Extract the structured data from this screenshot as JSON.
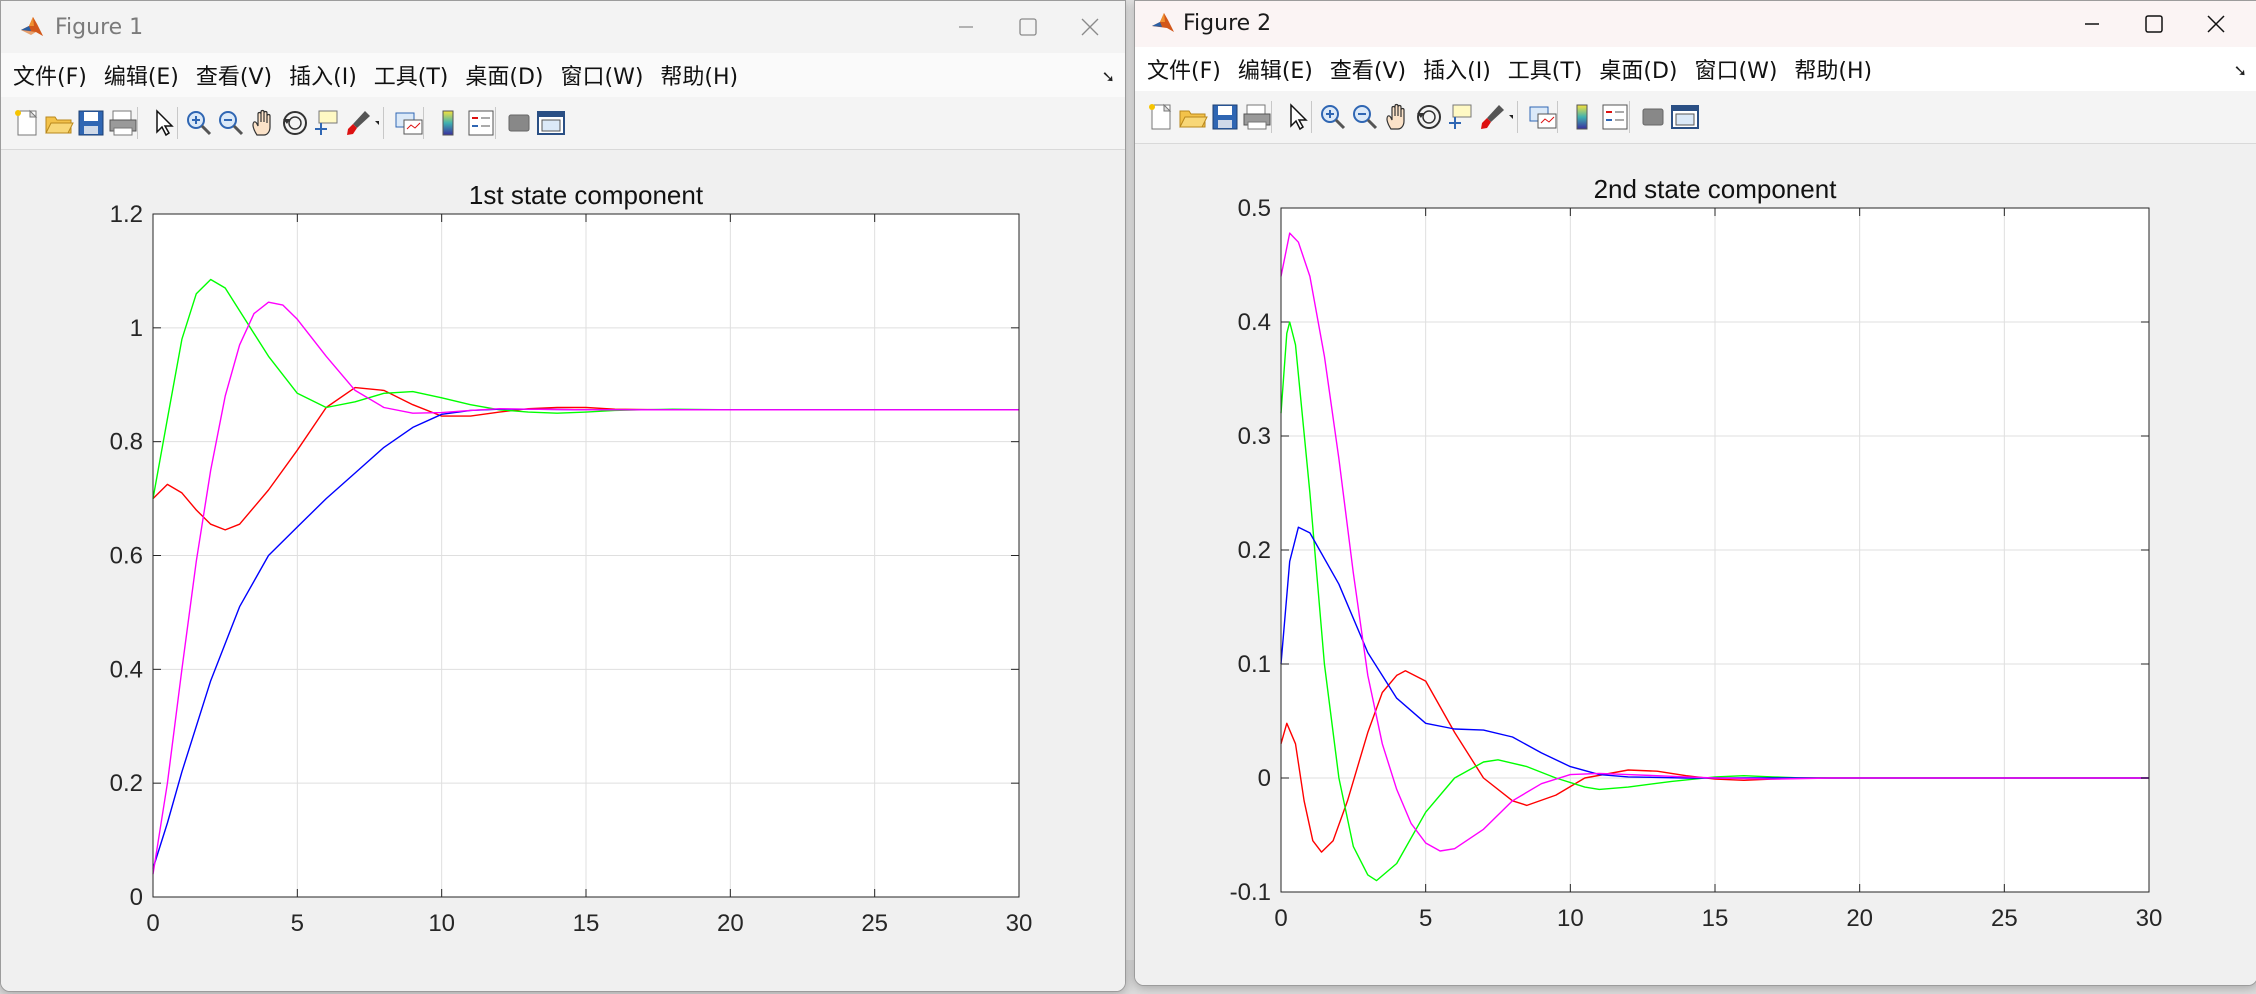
{
  "menu": [
    "文件(F)",
    "编辑(E)",
    "查看(V)",
    "插入(I)",
    "工具(T)",
    "桌面(D)",
    "窗口(W)",
    "帮助(H)"
  ],
  "figures": [
    {
      "title": "Figure 1",
      "active": false
    },
    {
      "title": "Figure 2",
      "active": true
    }
  ],
  "colors": {
    "red": "#ff0000",
    "green": "#00ff00",
    "blue": "#0000ff",
    "magenta": "#ff00ff"
  },
  "toolbar_icons": [
    "new-figure-icon",
    "open-file-icon",
    "save-icon",
    "print-icon",
    "pointer-icon",
    "zoom-in-icon",
    "zoom-out-icon",
    "pan-hand-icon",
    "rotate-3d-icon",
    "data-cursor-icon",
    "brush-icon",
    "brush-dropdown-icon",
    "link-plot-icon",
    "colorbar-icon",
    "legend-icon",
    "hide-plot-tools-icon",
    "show-plot-tools-icon"
  ],
  "chart_data": [
    {
      "type": "line",
      "title": "1st state component",
      "xlabel": "",
      "ylabel": "",
      "xlim": [
        0,
        30
      ],
      "ylim": [
        0,
        1.2
      ],
      "xticks": [
        "0",
        "5",
        "10",
        "15",
        "20",
        "25",
        "30"
      ],
      "yticks": [
        "0",
        "0.2",
        "0.4",
        "0.6",
        "0.8",
        "1",
        "1.2"
      ],
      "grid": true,
      "series": [
        {
          "color": "#ff0000",
          "points": [
            [
              0,
              0.7
            ],
            [
              0.5,
              0.725
            ],
            [
              1,
              0.71
            ],
            [
              1.5,
              0.68
            ],
            [
              2,
              0.655
            ],
            [
              2.5,
              0.645
            ],
            [
              3,
              0.655
            ],
            [
              4,
              0.715
            ],
            [
              5,
              0.785
            ],
            [
              6,
              0.86
            ],
            [
              7,
              0.895
            ],
            [
              8,
              0.89
            ],
            [
              9,
              0.865
            ],
            [
              10,
              0.845
            ],
            [
              11,
              0.845
            ],
            [
              12,
              0.852
            ],
            [
              13,
              0.858
            ],
            [
              14,
              0.86
            ],
            [
              15,
              0.86
            ],
            [
              16,
              0.857
            ],
            [
              18,
              0.856
            ],
            [
              20,
              0.856
            ],
            [
              30,
              0.856
            ]
          ]
        },
        {
          "color": "#00ff00",
          "points": [
            [
              0,
              0.7
            ],
            [
              0.5,
              0.84
            ],
            [
              1,
              0.98
            ],
            [
              1.5,
              1.06
            ],
            [
              2,
              1.085
            ],
            [
              2.5,
              1.07
            ],
            [
              3,
              1.03
            ],
            [
              4,
              0.95
            ],
            [
              5,
              0.885
            ],
            [
              6,
              0.86
            ],
            [
              7,
              0.87
            ],
            [
              8,
              0.885
            ],
            [
              9,
              0.888
            ],
            [
              10,
              0.877
            ],
            [
              11,
              0.865
            ],
            [
              12,
              0.856
            ],
            [
              13,
              0.852
            ],
            [
              14,
              0.85
            ],
            [
              15,
              0.852
            ],
            [
              16,
              0.855
            ],
            [
              18,
              0.857
            ],
            [
              20,
              0.856
            ],
            [
              30,
              0.856
            ]
          ]
        },
        {
          "color": "#0000ff",
          "points": [
            [
              0,
              0.05
            ],
            [
              0.5,
              0.13
            ],
            [
              1,
              0.22
            ],
            [
              2,
              0.38
            ],
            [
              3,
              0.51
            ],
            [
              4,
              0.6
            ],
            [
              5,
              0.65
            ],
            [
              6,
              0.7
            ],
            [
              7,
              0.745
            ],
            [
              8,
              0.79
            ],
            [
              9,
              0.825
            ],
            [
              10,
              0.848
            ],
            [
              11,
              0.855
            ],
            [
              12,
              0.857
            ],
            [
              13,
              0.857
            ],
            [
              15,
              0.856
            ],
            [
              20,
              0.856
            ],
            [
              30,
              0.856
            ]
          ]
        },
        {
          "color": "#ff00ff",
          "points": [
            [
              0,
              0.04
            ],
            [
              0.5,
              0.2
            ],
            [
              1,
              0.4
            ],
            [
              1.5,
              0.59
            ],
            [
              2,
              0.75
            ],
            [
              2.5,
              0.88
            ],
            [
              3,
              0.97
            ],
            [
              3.5,
              1.025
            ],
            [
              4,
              1.045
            ],
            [
              4.5,
              1.04
            ],
            [
              5,
              1.015
            ],
            [
              6,
              0.95
            ],
            [
              7,
              0.89
            ],
            [
              8,
              0.86
            ],
            [
              9,
              0.85
            ],
            [
              10,
              0.851
            ],
            [
              11,
              0.855
            ],
            [
              12,
              0.858
            ],
            [
              13,
              0.857
            ],
            [
              15,
              0.856
            ],
            [
              20,
              0.856
            ],
            [
              30,
              0.856
            ]
          ]
        }
      ]
    },
    {
      "type": "line",
      "title": "2nd state component",
      "xlabel": "",
      "ylabel": "",
      "xlim": [
        0,
        30
      ],
      "ylim": [
        -0.1,
        0.5
      ],
      "xticks": [
        "0",
        "5",
        "10",
        "15",
        "20",
        "25",
        "30"
      ],
      "yticks": [
        "-0.1",
        "0",
        "0.1",
        "0.2",
        "0.3",
        "0.4",
        "0.5"
      ],
      "grid": true,
      "series": [
        {
          "color": "#ff0000",
          "points": [
            [
              0,
              0.03
            ],
            [
              0.2,
              0.048
            ],
            [
              0.5,
              0.03
            ],
            [
              0.8,
              -0.02
            ],
            [
              1.1,
              -0.055
            ],
            [
              1.4,
              -0.065
            ],
            [
              1.8,
              -0.055
            ],
            [
              2.3,
              -0.02
            ],
            [
              3,
              0.04
            ],
            [
              3.5,
              0.075
            ],
            [
              4,
              0.09
            ],
            [
              4.3,
              0.094
            ],
            [
              5,
              0.085
            ],
            [
              6,
              0.04
            ],
            [
              7,
              0.0
            ],
            [
              8,
              -0.02
            ],
            [
              8.5,
              -0.024
            ],
            [
              9.5,
              -0.015
            ],
            [
              10.5,
              0.0
            ],
            [
              12,
              0.007
            ],
            [
              13,
              0.006
            ],
            [
              14,
              0.002
            ],
            [
              15,
              -0.001
            ],
            [
              16,
              -0.002
            ],
            [
              17,
              -0.001
            ],
            [
              18,
              0.0
            ],
            [
              30,
              0.0
            ]
          ]
        },
        {
          "color": "#00ff00",
          "points": [
            [
              0,
              0.32
            ],
            [
              0.2,
              0.39
            ],
            [
              0.3,
              0.4
            ],
            [
              0.5,
              0.38
            ],
            [
              1,
              0.25
            ],
            [
              1.5,
              0.1
            ],
            [
              2,
              0.0
            ],
            [
              2.5,
              -0.06
            ],
            [
              3,
              -0.085
            ],
            [
              3.3,
              -0.09
            ],
            [
              4,
              -0.075
            ],
            [
              5,
              -0.03
            ],
            [
              6,
              0.0
            ],
            [
              7,
              0.014
            ],
            [
              7.5,
              0.016
            ],
            [
              8.5,
              0.01
            ],
            [
              9.5,
              0.0
            ],
            [
              10.5,
              -0.008
            ],
            [
              11,
              -0.01
            ],
            [
              12,
              -0.008
            ],
            [
              13.5,
              -0.003
            ],
            [
              15,
              0.001
            ],
            [
              16,
              0.002
            ],
            [
              17,
              0.001
            ],
            [
              18,
              0.0
            ],
            [
              30,
              0.0
            ]
          ]
        },
        {
          "color": "#0000ff",
          "points": [
            [
              0,
              0.1
            ],
            [
              0.3,
              0.19
            ],
            [
              0.6,
              0.22
            ],
            [
              1,
              0.215
            ],
            [
              2,
              0.17
            ],
            [
              3,
              0.11
            ],
            [
              4,
              0.07
            ],
            [
              5,
              0.048
            ],
            [
              6,
              0.043
            ],
            [
              7,
              0.042
            ],
            [
              8,
              0.036
            ],
            [
              9,
              0.022
            ],
            [
              10,
              0.01
            ],
            [
              11,
              0.003
            ],
            [
              12,
              0.001
            ],
            [
              14,
              0.0
            ],
            [
              30,
              0.0
            ]
          ]
        },
        {
          "color": "#ff00ff",
          "points": [
            [
              0,
              0.44
            ],
            [
              0.3,
              0.478
            ],
            [
              0.6,
              0.47
            ],
            [
              1,
              0.44
            ],
            [
              1.5,
              0.37
            ],
            [
              2,
              0.28
            ],
            [
              2.5,
              0.18
            ],
            [
              3,
              0.09
            ],
            [
              3.5,
              0.03
            ],
            [
              4,
              -0.01
            ],
            [
              4.5,
              -0.04
            ],
            [
              5,
              -0.057
            ],
            [
              5.5,
              -0.064
            ],
            [
              6,
              -0.062
            ],
            [
              7,
              -0.045
            ],
            [
              8,
              -0.02
            ],
            [
              9,
              -0.005
            ],
            [
              10,
              0.003
            ],
            [
              11,
              0.004
            ],
            [
              12,
              0.003
            ],
            [
              13,
              0.002
            ],
            [
              14,
              0.001
            ],
            [
              15,
              0.0
            ],
            [
              17,
              -0.001
            ],
            [
              19,
              0.0
            ],
            [
              30,
              0.0
            ]
          ]
        }
      ]
    }
  ]
}
